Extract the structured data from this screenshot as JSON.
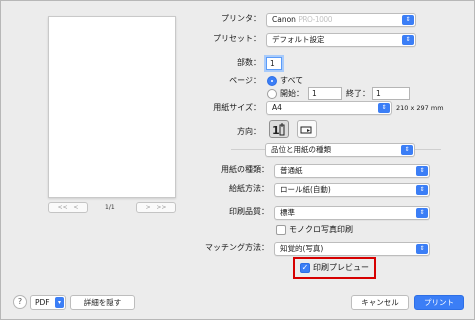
{
  "printer": {
    "label": "プリンタ：",
    "value": "Canon",
    "value_obscured": "PRO-1000"
  },
  "preset": {
    "label": "プリセット：",
    "value": "デフォルト設定"
  },
  "copies": {
    "label": "部数：",
    "value": "1"
  },
  "pages": {
    "label": "ページ：",
    "all_label": "すべて",
    "range_label": "開始：",
    "from_value": "1",
    "to_label": "終了：",
    "to_value": "1"
  },
  "paper_size": {
    "label": "用紙サイズ：",
    "value": "A4",
    "dimensions": "210 x 297 mm"
  },
  "orientation": {
    "label": "方向："
  },
  "section_popup": {
    "value": "品位と用紙の種類"
  },
  "media_type": {
    "label": "用紙の種類：",
    "value": "普通紙"
  },
  "paper_source": {
    "label": "給紙方法：",
    "value": "ロール紙(自動)"
  },
  "print_quality": {
    "label": "印刷品質：",
    "value": "標準"
  },
  "monochrome": {
    "label": "モノクロ写真印刷",
    "checked": false
  },
  "matching": {
    "label": "マッチング方法：",
    "value": "知覚的(写真)"
  },
  "print_preview": {
    "label": "印刷プレビュー",
    "checked": true
  },
  "preview_nav": {
    "first": "<<",
    "prev": "<",
    "page": "1/1",
    "next": ">",
    "last": ">>"
  },
  "footer": {
    "help": "?",
    "pdf": "PDF",
    "hide_details": "詳細を隠す",
    "cancel": "キャンセル",
    "print": "プリント"
  },
  "colors": {
    "accent": "#3b7ef6",
    "highlight_box": "#d60000"
  }
}
